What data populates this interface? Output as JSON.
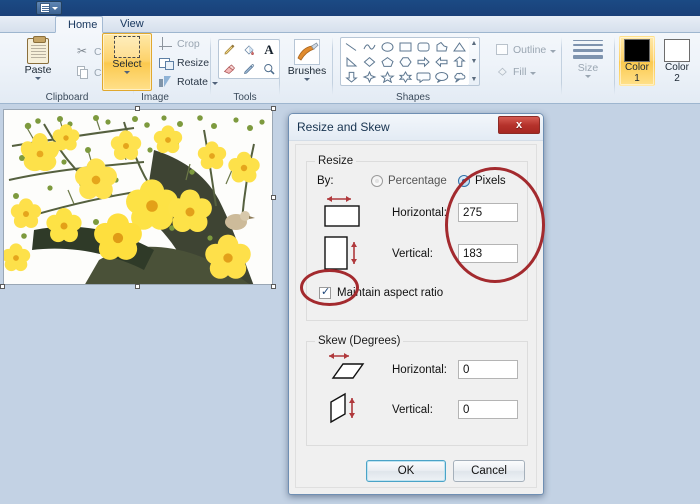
{
  "window": {
    "quick_access": {
      "icon": "document-icon",
      "dropdown": "caret-down-icon"
    },
    "tabs": [
      {
        "id": "home",
        "label": "Home",
        "active": true
      },
      {
        "id": "view",
        "label": "View",
        "active": false
      }
    ]
  },
  "ribbon": {
    "groups": [
      {
        "id": "clipboard",
        "label": "Clipboard",
        "big_button": {
          "label": "Paste",
          "icon": "clipboard-icon",
          "has_dropdown": true
        },
        "small_buttons": [
          {
            "label": "Cut",
            "icon": "scissors-icon",
            "disabled": true
          },
          {
            "label": "Copy",
            "icon": "copy-icon",
            "disabled": true
          }
        ]
      },
      {
        "id": "image",
        "label": "Image",
        "big_button": {
          "label": "Select",
          "icon": "selection-marquee-icon",
          "has_dropdown": true,
          "active": true
        },
        "small_buttons": [
          {
            "label": "Crop",
            "icon": "crop-icon",
            "disabled": true
          },
          {
            "label": "Resize",
            "icon": "resize-icon",
            "disabled": false
          },
          {
            "label": "Rotate",
            "icon": "rotate-icon",
            "disabled": false,
            "has_dropdown": true
          }
        ]
      },
      {
        "id": "tools",
        "label": "Tools",
        "items": [
          {
            "name": "pencil-icon"
          },
          {
            "name": "fill-with-color-icon"
          },
          {
            "name": "text-icon"
          },
          {
            "name": "eraser-icon"
          },
          {
            "name": "color-picker-icon"
          },
          {
            "name": "magnifier-icon"
          }
        ]
      },
      {
        "id": "brushes",
        "label": "",
        "big_button": {
          "label": "Brushes",
          "icon": "brushes-icon",
          "has_dropdown": true
        }
      },
      {
        "id": "shapes",
        "label": "Shapes",
        "shapes": [
          "line-shape",
          "curve-shape",
          "oval-shape",
          "rectangle-shape",
          "rounded-rectangle-shape",
          "polygon-shape",
          "triangle-shape",
          "right-triangle-shape",
          "diamond-shape",
          "pentagon-shape",
          "hexagon-shape",
          "right-arrow-shape",
          "left-arrow-shape",
          "up-arrow-shape",
          "down-arrow-shape",
          "four-point-star-shape",
          "five-point-star-shape",
          "six-point-star-shape",
          "rounded-callout-shape",
          "oval-callout-shape",
          "cloud-callout-shape"
        ],
        "scroll": {
          "up": "▲",
          "down": "▼",
          "more": "▼"
        },
        "outline": {
          "label": "Outline",
          "icon": "outline-icon",
          "disabled": true,
          "has_dropdown": true
        },
        "fill": {
          "label": "Fill",
          "icon": "fill-icon",
          "disabled": true,
          "has_dropdown": true
        }
      },
      {
        "id": "size",
        "label": "",
        "button": {
          "label": "Size",
          "icon": "size-lines-icon",
          "disabled": true,
          "has_dropdown": true
        }
      },
      {
        "id": "colors",
        "label": "",
        "color1": {
          "label_top": "Color",
          "label_bottom": "1",
          "swatch": "#000000",
          "selected": true
        },
        "color2": {
          "label_top": "Color",
          "label_bottom": "2",
          "swatch": "#ffffff",
          "selected": false
        }
      }
    ]
  },
  "canvas": {
    "image_alt": "yellow-apricot-blossom-photo",
    "selection_handles": 8
  },
  "dialog": {
    "title": "Resize and Skew",
    "close_label": "x",
    "resize": {
      "legend": "Resize",
      "by_label": "By:",
      "options": [
        {
          "id": "percentage",
          "label": "Percentage",
          "selected": false
        },
        {
          "id": "pixels",
          "label": "Pixels",
          "selected": true
        }
      ],
      "horizontal_label": "Horizontal:",
      "horizontal_value": "275",
      "vertical_label": "Vertical:",
      "vertical_value": "183",
      "maintain_aspect_label": "Maintain aspect ratio",
      "maintain_aspect_checked": true
    },
    "skew": {
      "legend": "Skew (Degrees)",
      "horizontal_label": "Horizontal:",
      "horizontal_value": "0",
      "vertical_label": "Vertical:",
      "vertical_value": "0"
    },
    "buttons": {
      "ok": "OK",
      "cancel": "Cancel"
    }
  },
  "annotations": {
    "circle_color": "#a32a2e",
    "marks": [
      {
        "id": "pixels-fields-circle",
        "targets": "Pixels radio, Horizontal 275, Vertical 183"
      },
      {
        "id": "maintain-aspect-circle",
        "targets": "Maintain aspect ratio checkbox"
      }
    ]
  }
}
